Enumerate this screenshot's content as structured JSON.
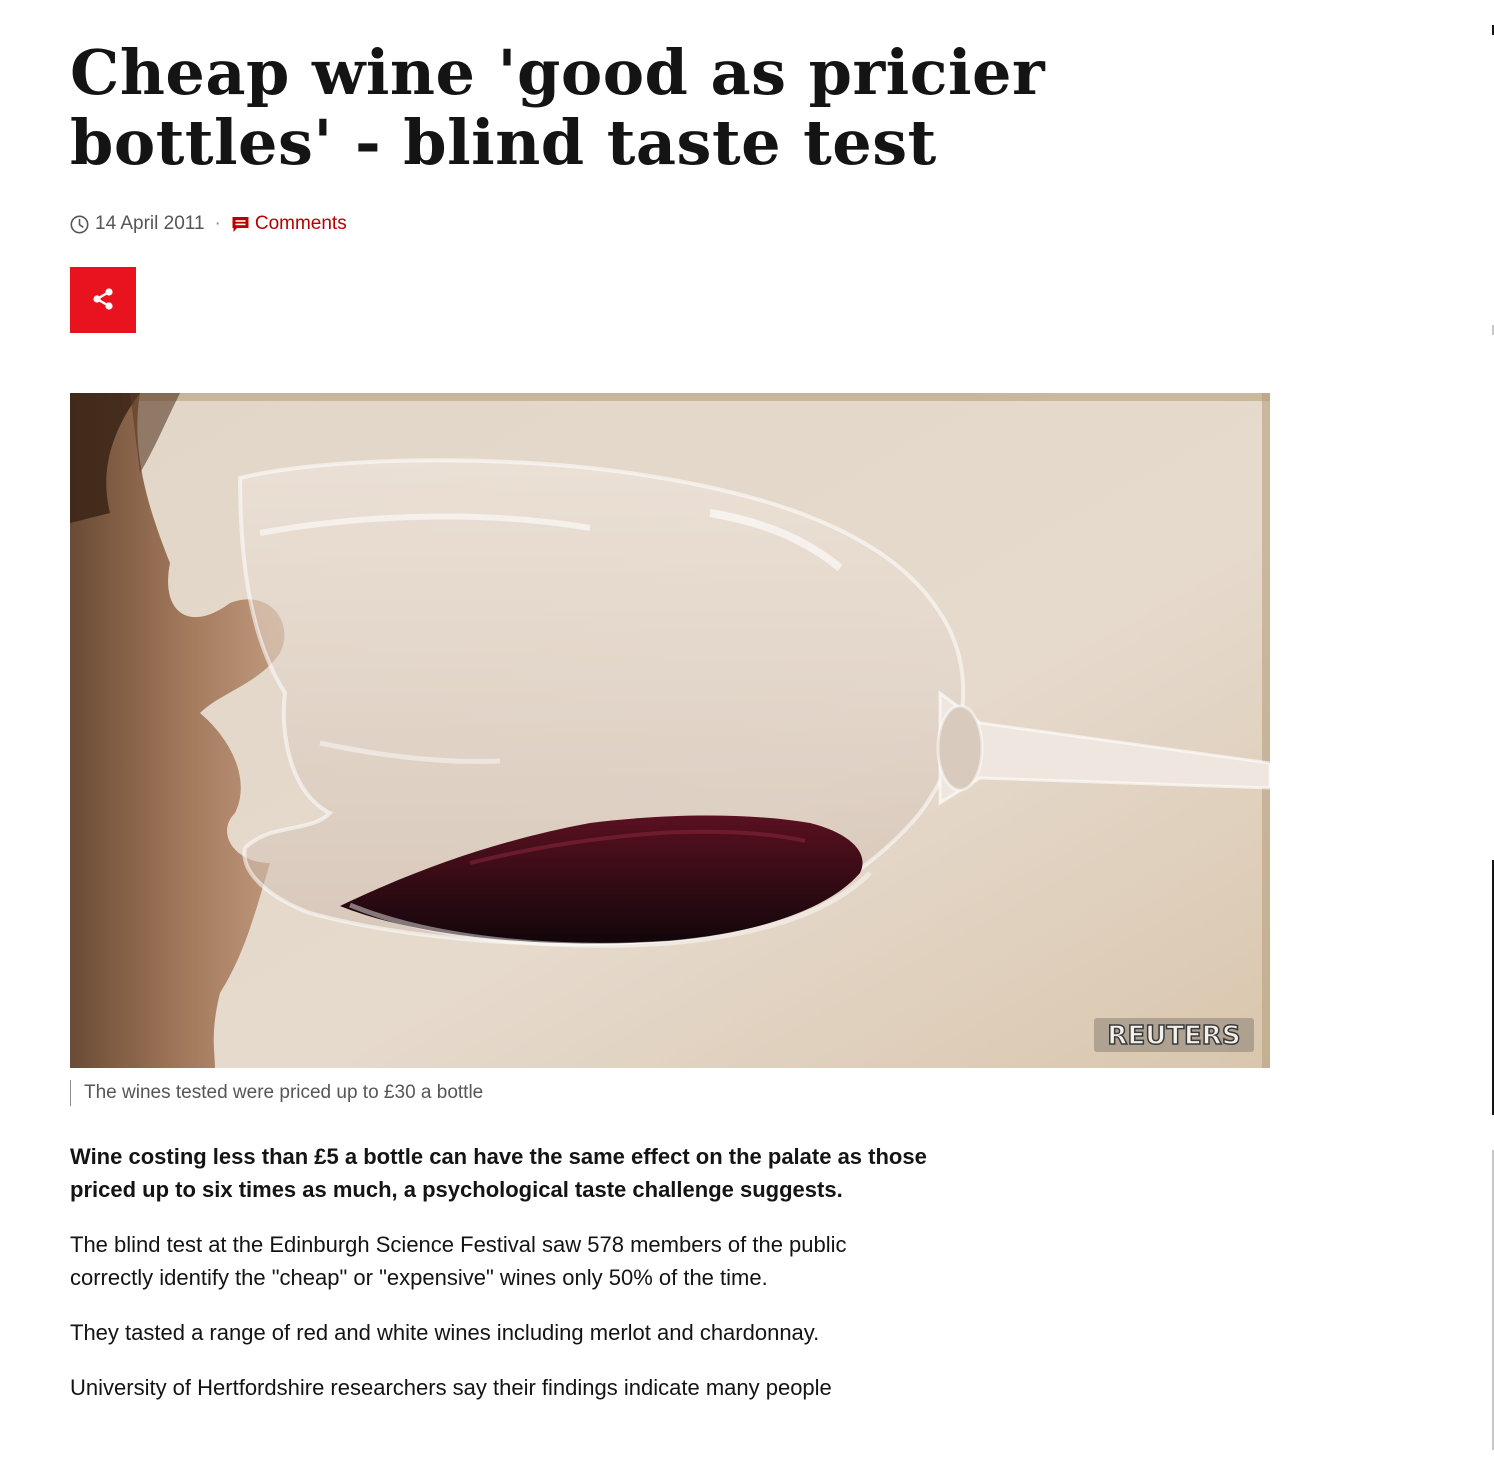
{
  "article": {
    "headline": "Cheap wine 'good as pricier bottles' - blind taste test",
    "date": "14 April 2011",
    "separator": "·",
    "comments_label": "Comments",
    "share_label": "Share",
    "image": {
      "watermark": "REUTERS",
      "caption": "The wines tested were priced up to £30 a bottle"
    },
    "paragraphs": [
      "Wine costing less than £5 a bottle can have the same effect on the palate as those priced up to six times as much, a psychological taste challenge suggests.",
      "The blind test at the Edinburgh Science Festival saw 578 members of the public correctly identify the \"cheap\" or \"expensive\" wines only 50% of the time.",
      "They tasted a range of red and white wines including merlot and chardonnay.",
      "University of Hertfordshire researchers say their findings indicate many people"
    ]
  },
  "colors": {
    "accent": "#b80000",
    "share_bg": "#e8131e",
    "text": "#141414",
    "muted": "#545658"
  },
  "icons": {
    "clock": "clock-icon",
    "comments": "comments-icon",
    "share": "share-icon"
  }
}
